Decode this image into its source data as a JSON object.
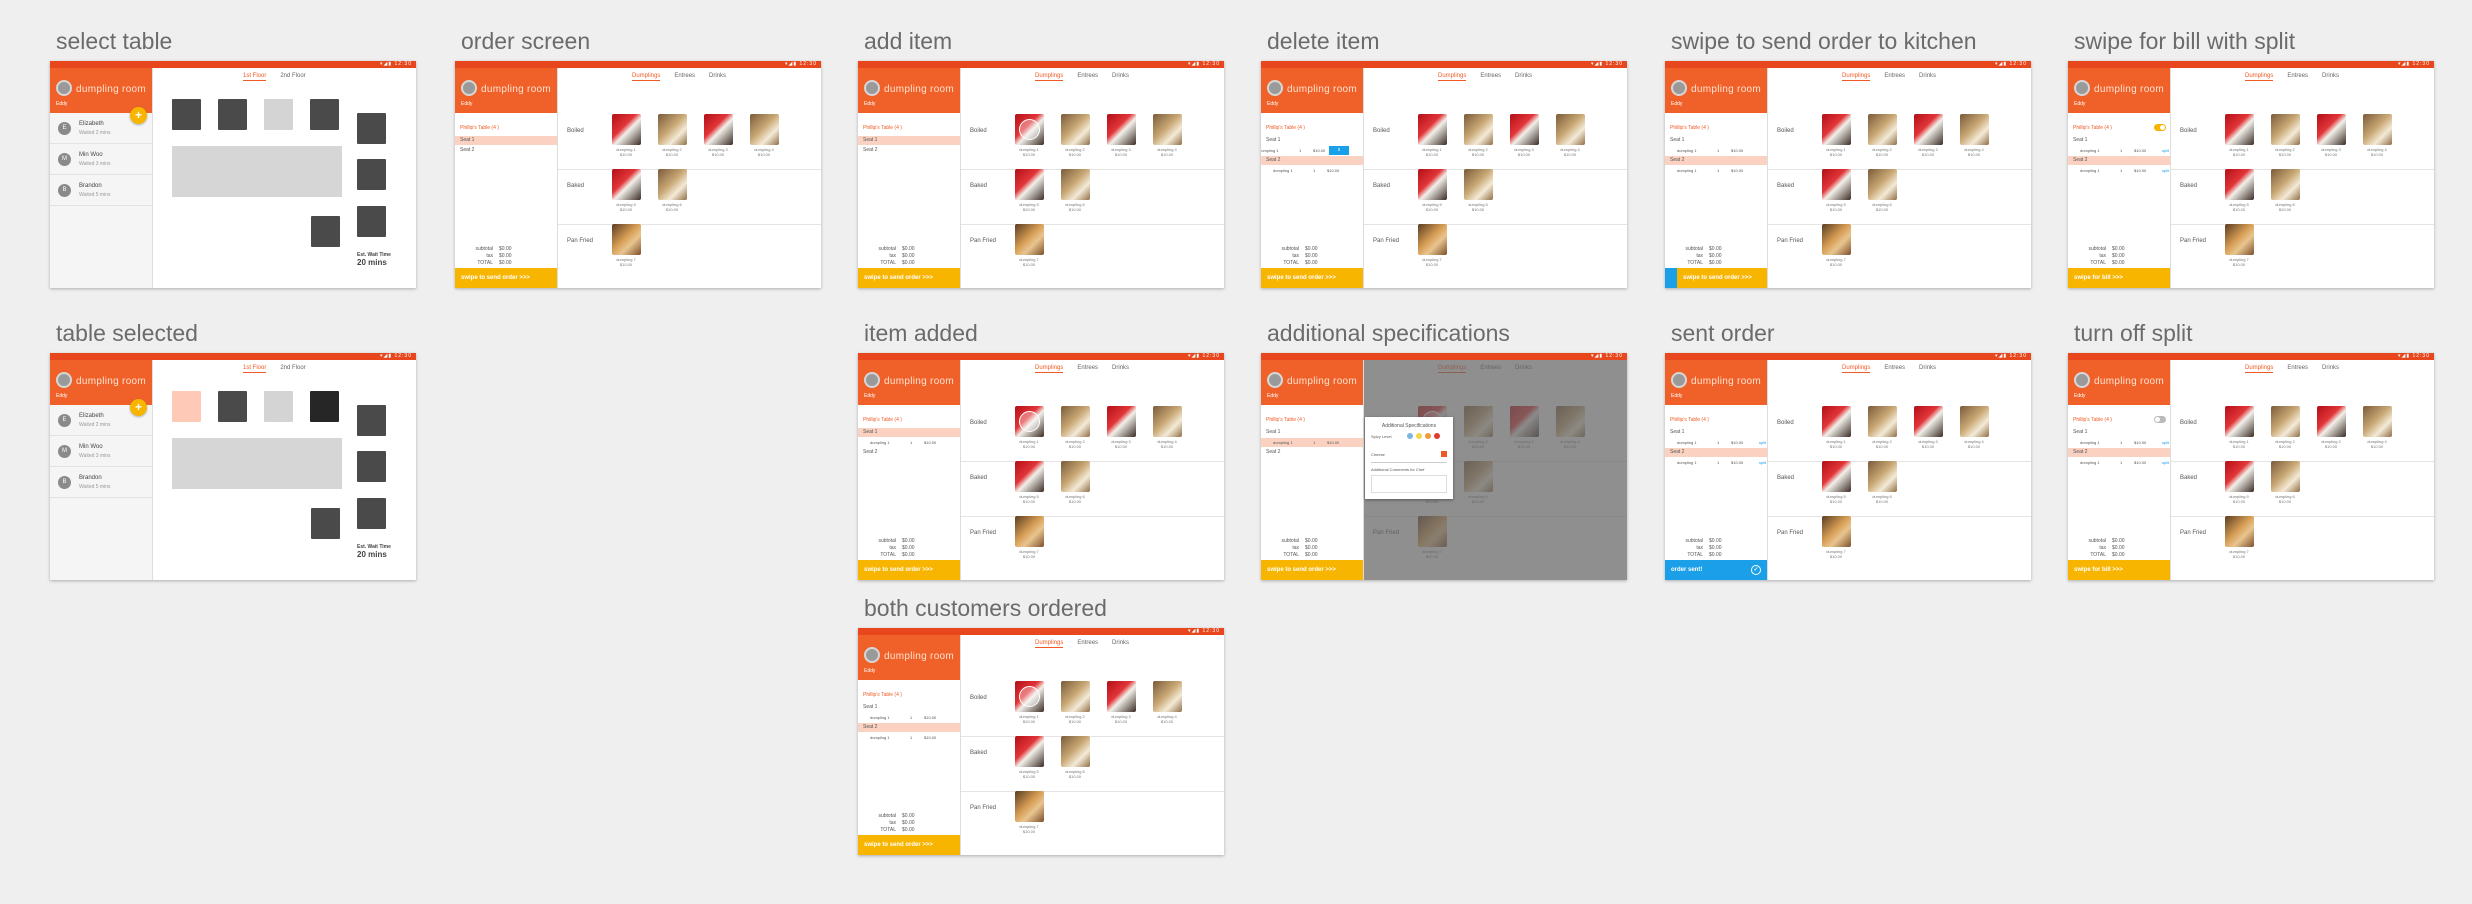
{
  "frames": [
    {
      "kind": "tables",
      "title": "select table"
    },
    {
      "kind": "order",
      "title": "order screen",
      "variant": "order"
    },
    {
      "kind": "order",
      "title": "add item",
      "variant": "add"
    },
    {
      "kind": "order",
      "title": "delete item",
      "variant": "delete"
    },
    {
      "kind": "order",
      "title": "swipe to send order to kitchen",
      "variant": "send"
    },
    {
      "kind": "order",
      "title": "swipe for bill with split",
      "variant": "bill"
    },
    {
      "kind": "tables",
      "title": "table selected"
    },
    {
      "kind": "order",
      "title": "item added",
      "variant": "added"
    },
    {
      "kind": "order",
      "title": "additional specifications",
      "variant": "spec"
    },
    {
      "kind": "order",
      "title": "sent order",
      "variant": "sent"
    },
    {
      "kind": "order",
      "title": "turn off split",
      "variant": "off"
    },
    {
      "kind": "order",
      "title": "both customers ordered",
      "variant": "both"
    }
  ],
  "status_icons": "▾◢▮ 12:30",
  "brand": "dumpling room",
  "employee": "Eddy",
  "fab_label": "+",
  "waitlist": [
    {
      "initial": "E",
      "name": "Elizabeth",
      "sub": "Waited 2 mins"
    },
    {
      "initial": "M",
      "name": "Min Woo",
      "sub": "Waited 3 mins"
    },
    {
      "initial": "B",
      "name": "Brandon",
      "sub": "Waited 5 mins"
    }
  ],
  "floor_tabs": [
    "1st Floor",
    "2nd Floor"
  ],
  "wait": {
    "label": "Est. Wait Time",
    "value": "20 mins"
  },
  "menu_tabs": [
    "Dumplings",
    "Entrees",
    "Drinks"
  ],
  "table_name": "Phillip's Table (4 )",
  "seats": [
    "Seat 1",
    "Seat 2"
  ],
  "sections": [
    "Boiled",
    "Baked",
    "Pan Fried"
  ],
  "dishes": [
    {
      "name": "dumpling 1",
      "price": "$10.00"
    },
    {
      "name": "dumpling 2",
      "price": "$10.00"
    },
    {
      "name": "dumpling 3",
      "price": "$10.00"
    },
    {
      "name": "dumpling 4",
      "price": "$10.00"
    },
    {
      "name": "dumpling 5",
      "price": "$10.00"
    },
    {
      "name": "dumpling 6",
      "price": "$10.00"
    },
    {
      "name": "dumpling 7",
      "price": "$10.00"
    }
  ],
  "order_line": {
    "name": "dumpling 1",
    "qty": "1",
    "price": "$10.00"
  },
  "totals": {
    "subtotal_label": "subtotal",
    "subtotal": "$0.00",
    "tax_label": "tax",
    "tax": "$0.00",
    "total_label": "TOTAL",
    "total": "$0.00"
  },
  "swipe_send": "swipe to send order",
  "swipe_bill": "swipe for bill",
  "sent_label": "order sent!",
  "delete_label": "x",
  "split_label": "split",
  "spec": {
    "title": "Additional Specifications",
    "spicy": "Spicy Level",
    "cheese": "Cheese",
    "notes": "Additional Comments for Chef"
  },
  "colors": {
    "brand": "#f0612a",
    "accent": "#f7b500",
    "blue": "#1a9fe8"
  }
}
